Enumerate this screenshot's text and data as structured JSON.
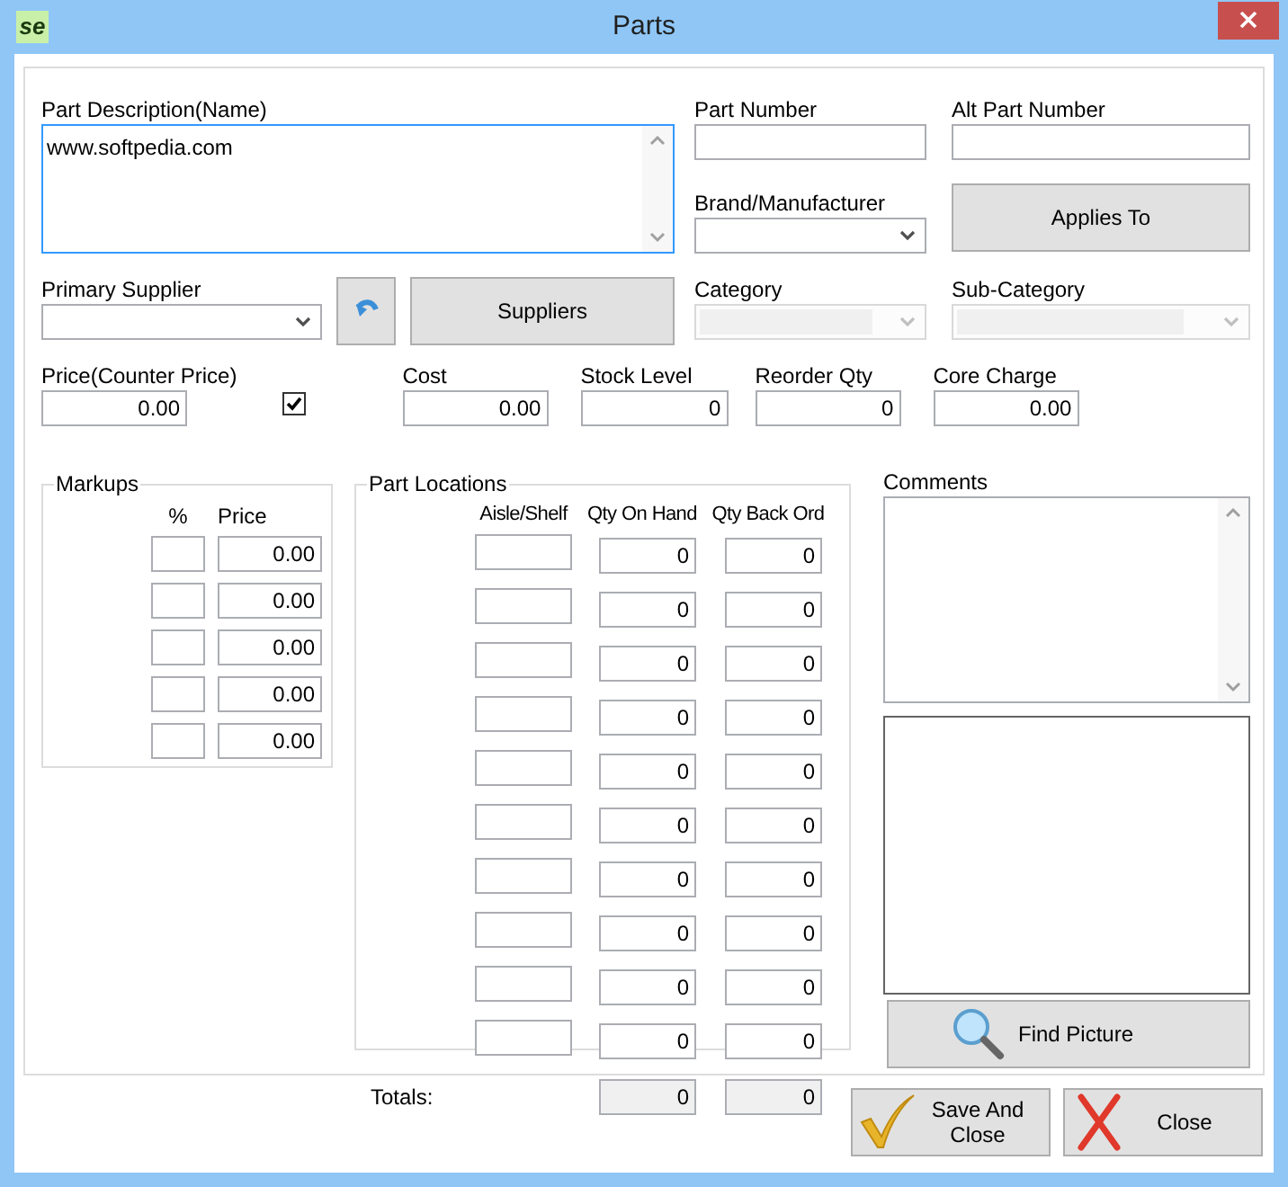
{
  "window": {
    "logo": "se",
    "title": "Parts"
  },
  "description": {
    "label": "Part Description(Name)",
    "value": "www.softpedia.com"
  },
  "part_number": {
    "label": "Part Number"
  },
  "alt_part_number": {
    "label": "Alt Part Number"
  },
  "brand": {
    "label": "Brand/Manufacturer",
    "disabled": false
  },
  "applies_to_button": "Applies To",
  "primary_supplier": {
    "label": "Primary Supplier",
    "disabled": false
  },
  "suppliers_button": "Suppliers",
  "category": {
    "label": "Category",
    "disabled": true
  },
  "sub_category": {
    "label": "Sub-Category",
    "disabled": true
  },
  "price": {
    "label": "Price(Counter Price)",
    "value": "0.00",
    "checked": true
  },
  "cost": {
    "label": "Cost",
    "value": "0.00"
  },
  "stock_level": {
    "label": "Stock Level",
    "value": "0"
  },
  "reorder_qty": {
    "label": "Reorder Qty",
    "value": "0"
  },
  "core_charge": {
    "label": "Core Charge",
    "value": "0.00"
  },
  "markups": {
    "title": "Markups",
    "columns": [
      "%",
      "Price"
    ],
    "rows": [
      {
        "price": "0.00"
      },
      {
        "price": "0.00"
      },
      {
        "price": "0.00"
      },
      {
        "price": "0.00"
      },
      {
        "price": "0.00"
      }
    ]
  },
  "part_locations": {
    "title": "Part Locations",
    "columns": [
      "Aisle/Shelf",
      "Qty On Hand",
      "Qty Back Ord"
    ],
    "rows": [
      {
        "on_hand": "0",
        "back_ord": "0"
      },
      {
        "on_hand": "0",
        "back_ord": "0"
      },
      {
        "on_hand": "0",
        "back_ord": "0"
      },
      {
        "on_hand": "0",
        "back_ord": "0"
      },
      {
        "on_hand": "0",
        "back_ord": "0"
      },
      {
        "on_hand": "0",
        "back_ord": "0"
      },
      {
        "on_hand": "0",
        "back_ord": "0"
      },
      {
        "on_hand": "0",
        "back_ord": "0"
      },
      {
        "on_hand": "0",
        "back_ord": "0"
      },
      {
        "on_hand": "0",
        "back_ord": "0"
      }
    ],
    "totals": {
      "label": "Totals:",
      "on_hand": "0",
      "back_ord": "0"
    }
  },
  "comments": {
    "label": "Comments"
  },
  "find_picture_button": "Find Picture",
  "buttons": [
    {
      "kind": "save",
      "label": "Save And Close"
    },
    {
      "kind": "close",
      "label": "Close"
    }
  ]
}
